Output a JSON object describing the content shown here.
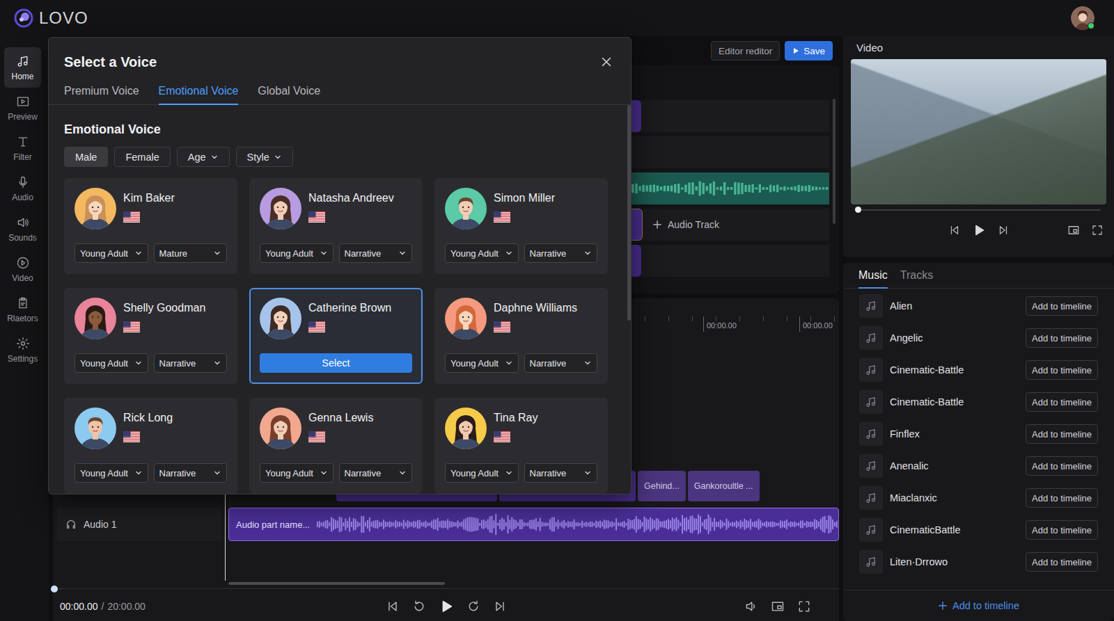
{
  "app": {
    "logo": "LOVO"
  },
  "sidebar": {
    "items": [
      {
        "label": "Home",
        "selected": true
      },
      {
        "label": "Preview",
        "selected": false
      },
      {
        "label": "Filter",
        "selected": false
      },
      {
        "label": "Audio",
        "selected": false
      },
      {
        "label": "Sounds",
        "selected": false
      },
      {
        "label": "Video",
        "selected": false
      },
      {
        "label": "Rlaetors",
        "selected": false
      },
      {
        "label": "Settings",
        "selected": false
      }
    ]
  },
  "editor": {
    "toolbar": [
      {
        "label": "Editor reditor",
        "kind": "secondary"
      },
      {
        "label": "Save",
        "kind": "primary"
      }
    ],
    "add_track": "Audio Track",
    "ruler": [
      "00:00.00",
      "00:00.00"
    ],
    "clips": [
      "Gehind...",
      "Gankoroultle ..."
    ],
    "audio_track": {
      "name": "Audio 1",
      "clip": "Audio part name..."
    },
    "transport": {
      "current": "00:00.00",
      "separator": "/",
      "total": "20:00.00",
      "level": 0
    }
  },
  "video": {
    "title": "Video",
    "level": 0
  },
  "library": {
    "tabs": [
      {
        "label": "Music",
        "selected": true
      },
      {
        "label": "Tracks",
        "selected": false
      }
    ],
    "tracks": [
      {
        "name": "Alien",
        "action": "Add to timeline"
      },
      {
        "name": "Angelic",
        "action": "Add to timeline"
      },
      {
        "name": "Cinematic-Battle",
        "action": "Add to timeline"
      },
      {
        "name": "Cinematic-Battle",
        "action": "Add to timeline"
      },
      {
        "name": "Finflex",
        "action": "Add to timeline"
      },
      {
        "name": "Anenalic",
        "action": "Add to timeline"
      },
      {
        "name": "Miaclanxic",
        "action": "Add to timeline"
      },
      {
        "name": "CinematicBattle",
        "action": "Add to timeline"
      },
      {
        "name": "Liten·Drrowo",
        "action": "Add to timeline"
      }
    ],
    "footer": "Add to timeline"
  },
  "modal": {
    "title": "Select a Voice",
    "tabs": [
      {
        "label": "Premium Voice",
        "selected": false
      },
      {
        "label": "Emotional Voice",
        "selected": true
      },
      {
        "label": "Global Voice",
        "selected": false
      }
    ],
    "section": "Emotional Voice",
    "filters": [
      {
        "label": "Male",
        "kind": "chip",
        "selected": true
      },
      {
        "label": "Female",
        "kind": "chip",
        "selected": false
      },
      {
        "label": "Age",
        "kind": "dropdown",
        "selected": false
      },
      {
        "label": "Style",
        "kind": "dropdown",
        "selected": false
      }
    ],
    "select_label": "Select",
    "voices": [
      {
        "name": "Kim Baker",
        "kind": "female",
        "color": "#f4b860",
        "hair": "#c9905a",
        "skin": "#f7d6bd",
        "selected": false,
        "tags": [
          "Young Adult",
          "Mature"
        ]
      },
      {
        "name": "Natasha Andreev",
        "kind": "female",
        "color": "#b89be0",
        "hair": "#4a2e25",
        "skin": "#f2cdb5",
        "selected": false,
        "tags": [
          "Young Adult",
          "Narrative"
        ]
      },
      {
        "name": "Simon Miller",
        "kind": "male",
        "color": "#5cc9a7",
        "hair": "#6a4630",
        "skin": "#f2cdb5",
        "selected": false,
        "tags": [
          "Young Adult",
          "Narrative"
        ]
      },
      {
        "name": "Shelly Goodman",
        "kind": "female",
        "color": "#e9849b",
        "hair": "#2a1a14",
        "skin": "#8a5a3c",
        "selected": false,
        "tags": [
          "Young Adult",
          "Narrative"
        ]
      },
      {
        "name": "Catherine Brown",
        "kind": "female",
        "color": "#a6c3ea",
        "hair": "#3d2a22",
        "skin": "#f2d0ba",
        "selected": true,
        "tags": []
      },
      {
        "name": "Daphne Williams",
        "kind": "female",
        "color": "#f39a80",
        "hair": "#d2693c",
        "skin": "#f7d6bd",
        "selected": false,
        "tags": [
          "Young Adult",
          "Narrative"
        ]
      },
      {
        "name": "Rick Long",
        "kind": "male",
        "color": "#8ccaf0",
        "hair": "#6a4630",
        "skin": "#eec3a6",
        "selected": false,
        "tags": [
          "Young Adult",
          "Narrative"
        ]
      },
      {
        "name": "Genna Lewis",
        "kind": "female",
        "color": "#f2a88e",
        "hair": "#7a3f2b",
        "skin": "#f2cdb5",
        "selected": false,
        "tags": [
          "Young Adult",
          "Narrative"
        ]
      },
      {
        "name": "Tina Ray",
        "kind": "female",
        "color": "#f6cb4a",
        "hair": "#2a1c18",
        "skin": "#f0c8ae",
        "selected": false,
        "tags": [
          "Young Adult",
          "Narrative"
        ]
      }
    ]
  }
}
